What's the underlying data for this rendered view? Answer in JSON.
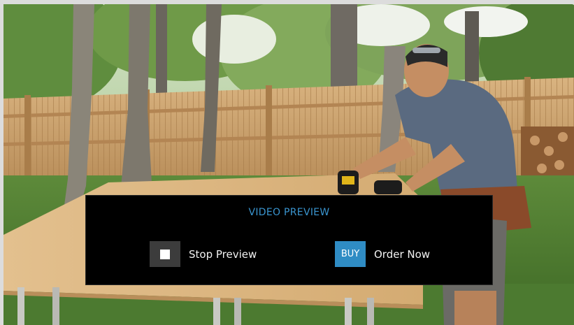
{
  "video_preview": {
    "title": "VIDEO PREVIEW",
    "stop_button": {
      "label": "Stop Preview",
      "icon": "stop-icon"
    },
    "buy_button": {
      "badge": "BUY",
      "label": "Order Now"
    }
  },
  "colors": {
    "accent": "#2f8cc4",
    "title": "#3a95cf",
    "stop_button_bg": "#3c3c3c",
    "overlay_bg": "#000000",
    "label_text": "#f2f2f2"
  }
}
